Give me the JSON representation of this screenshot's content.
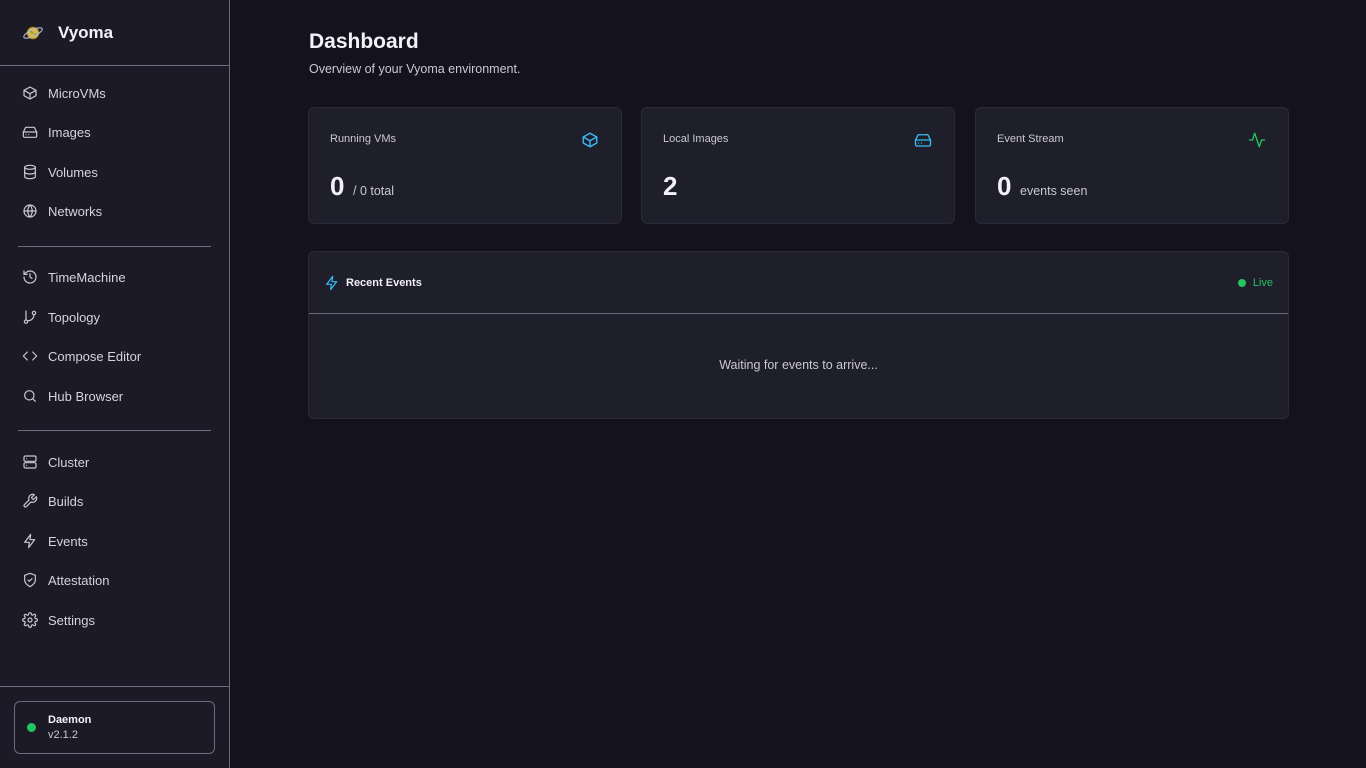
{
  "app": {
    "name": "Vyoma"
  },
  "sidebar": {
    "groups": [
      [
        {
          "id": "microvms",
          "label": "MicroVMs",
          "icon": "box-icon"
        },
        {
          "id": "images",
          "label": "Images",
          "icon": "hard-drive-icon"
        },
        {
          "id": "volumes",
          "label": "Volumes",
          "icon": "database-icon"
        },
        {
          "id": "networks",
          "label": "Networks",
          "icon": "globe-icon"
        }
      ],
      [
        {
          "id": "timemachine",
          "label": "TimeMachine",
          "icon": "history-icon"
        },
        {
          "id": "topology",
          "label": "Topology",
          "icon": "git-branch-icon"
        },
        {
          "id": "compose-editor",
          "label": "Compose Editor",
          "icon": "code-icon"
        },
        {
          "id": "hub-browser",
          "label": "Hub Browser",
          "icon": "search-icon"
        }
      ],
      [
        {
          "id": "cluster",
          "label": "Cluster",
          "icon": "server-icon"
        },
        {
          "id": "builds",
          "label": "Builds",
          "icon": "wrench-icon"
        },
        {
          "id": "events",
          "label": "Events",
          "icon": "zap-icon"
        },
        {
          "id": "attestation",
          "label": "Attestation",
          "icon": "shield-check-icon"
        },
        {
          "id": "settings",
          "label": "Settings",
          "icon": "gear-icon"
        }
      ]
    ],
    "daemon": {
      "name": "Daemon",
      "version": "v2.1.2",
      "status_color": "#22c55e"
    }
  },
  "header": {
    "title": "Dashboard",
    "subtitle": "Overview of your Vyoma environment."
  },
  "stats": {
    "running_vms": {
      "label": "Running VMs",
      "value": "0",
      "suffix": "/ 0 total",
      "icon": "box-icon",
      "color": "#38bdf8"
    },
    "local_images": {
      "label": "Local Images",
      "value": "2",
      "icon": "hard-drive-icon",
      "color": "#38bdf8"
    },
    "event_stream": {
      "label": "Event Stream",
      "value": "0",
      "suffix": "events seen",
      "icon": "activity-icon",
      "color": "#22c55e"
    }
  },
  "recent_events": {
    "title": "Recent Events",
    "status": "Live",
    "empty_text": "Waiting for events to arrive..."
  },
  "colors": {
    "background": "#13121d",
    "sidebar": "#1b1a26",
    "card": "#1f1e2b",
    "accent_cyan": "#38bdf8",
    "accent_green": "#22c55e"
  }
}
